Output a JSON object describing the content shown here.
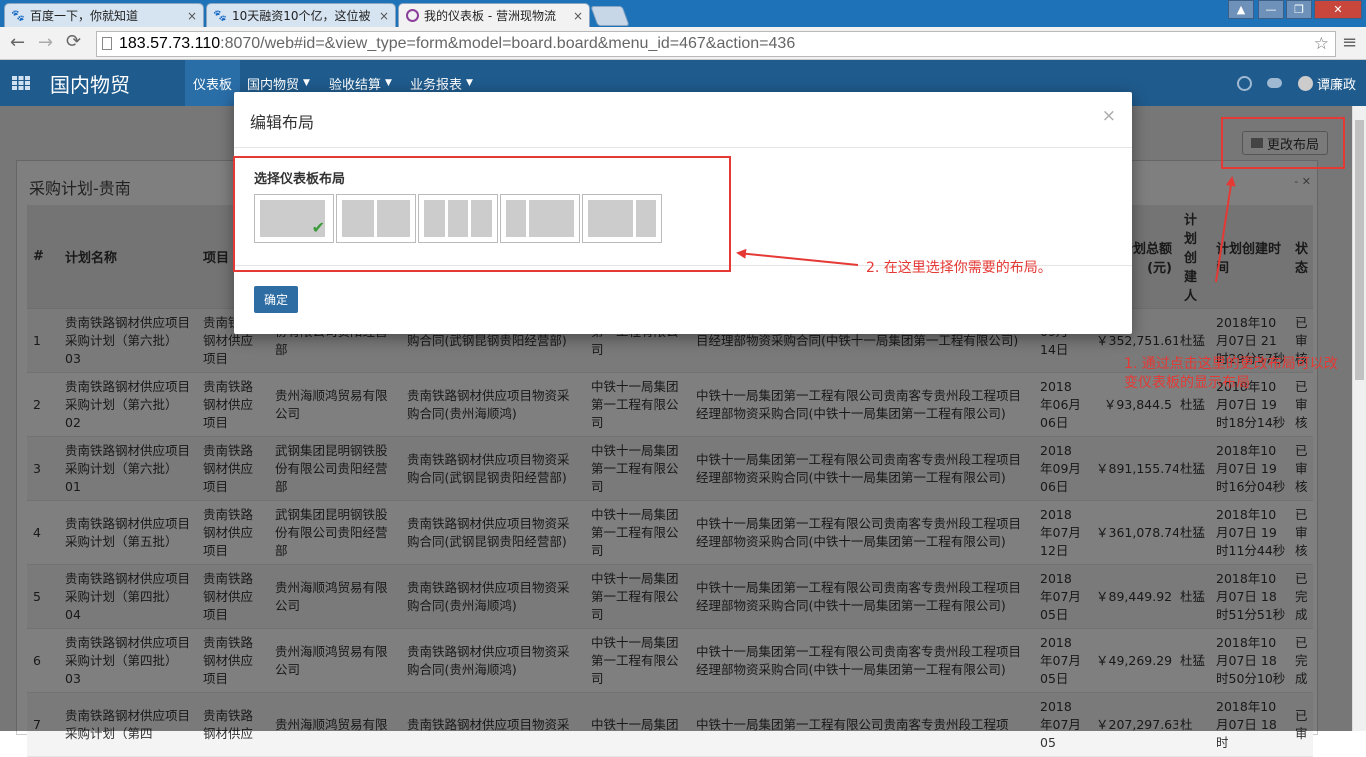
{
  "browser": {
    "tabs": [
      {
        "title": "百度一下，你就知道",
        "icon": "baidu-paw-icon"
      },
      {
        "title": "10天融资10个亿，这位被",
        "icon": "baidu-paw-icon"
      },
      {
        "title": "我的仪表板 - 营洲现物流",
        "icon": "odoo-ring-icon"
      }
    ],
    "url_host": "183.57.73.110",
    "url_rest": ":8070/web#id=&view_type=form&model=board.board&menu_id=467&action=436"
  },
  "app": {
    "title": "国内物贸",
    "menus": [
      {
        "label": "仪表板",
        "caret": false
      },
      {
        "label": "国内物贸",
        "caret": true
      },
      {
        "label": "验收结算",
        "caret": true
      },
      {
        "label": "业务报表",
        "caret": true
      }
    ],
    "user": "谭廉政"
  },
  "dashboard": {
    "change_layout_label": "更改布局",
    "panel_title": "采购计划-贵南",
    "panel_tools": "- ✕",
    "columns": [
      "#",
      "计划名称",
      "项目",
      "",
      "",
      "",
      "",
      "",
      "计划总额(元)",
      "计划创建人",
      "计划创建时间",
      "状态"
    ],
    "rows": [
      {
        "no": "1",
        "name": "贵南铁路钢材供应项目采购计划（第六批）03",
        "project": "贵南铁路钢材供应项目",
        "supplier": "份有限公司贵阳经营部",
        "contract": "购合同(武钢昆钢贵阳经营部)",
        "unit": "第一工程有限公司",
        "detail": "目经理部物资采购合同(中铁十一局集团第一工程有限公司)",
        "date": "09月14日",
        "amount": "￥352,751.61",
        "creator": "杜猛",
        "created": "2018年10月07日 21时29分57秒",
        "status": "已审核"
      },
      {
        "no": "2",
        "name": "贵南铁路钢材供应项目采购计划（第六批）02",
        "project": "贵南铁路钢材供应项目",
        "supplier": "贵州海顺鸿贸易有限公司",
        "contract": "贵南铁路钢材供应项目物资采购合同(贵州海顺鸿)",
        "unit": "中铁十一局集团第一工程有限公司",
        "detail": "中铁十一局集团第一工程有限公司贵南客专贵州段工程项目经理部物资采购合同(中铁十一局集团第一工程有限公司)",
        "date": "2018年06月06日",
        "amount": "￥93,844.5",
        "creator": "杜猛",
        "created": "2018年10月07日 19时18分14秒",
        "status": "已审核"
      },
      {
        "no": "3",
        "name": "贵南铁路钢材供应项目采购计划（第六批）01",
        "project": "贵南铁路钢材供应项目",
        "supplier": "武钢集团昆明钢铁股份有限公司贵阳经营部",
        "contract": "贵南铁路钢材供应项目物资采购合同(武钢昆钢贵阳经营部)",
        "unit": "中铁十一局集团第一工程有限公司",
        "detail": "中铁十一局集团第一工程有限公司贵南客专贵州段工程项目经理部物资采购合同(中铁十一局集团第一工程有限公司)",
        "date": "2018年09月06日",
        "amount": "￥891,155.74",
        "creator": "杜猛",
        "created": "2018年10月07日 19时16分04秒",
        "status": "已审核"
      },
      {
        "no": "4",
        "name": "贵南铁路钢材供应项目采购计划（第五批）",
        "project": "贵南铁路钢材供应项目",
        "supplier": "武钢集团昆明钢铁股份有限公司贵阳经营部",
        "contract": "贵南铁路钢材供应项目物资采购合同(武钢昆钢贵阳经营部)",
        "unit": "中铁十一局集团第一工程有限公司",
        "detail": "中铁十一局集团第一工程有限公司贵南客专贵州段工程项目经理部物资采购合同(中铁十一局集团第一工程有限公司)",
        "date": "2018年07月12日",
        "amount": "￥361,078.74",
        "creator": "杜猛",
        "created": "2018年10月07日 19时11分44秒",
        "status": "已审核"
      },
      {
        "no": "5",
        "name": "贵南铁路钢材供应项目采购计划（第四批）04",
        "project": "贵南铁路钢材供应项目",
        "supplier": "贵州海顺鸿贸易有限公司",
        "contract": "贵南铁路钢材供应项目物资采购合同(贵州海顺鸿)",
        "unit": "中铁十一局集团第一工程有限公司",
        "detail": "中铁十一局集团第一工程有限公司贵南客专贵州段工程项目经理部物资采购合同(中铁十一局集团第一工程有限公司)",
        "date": "2018年07月05日",
        "amount": "￥89,449.92",
        "creator": "杜猛",
        "created": "2018年10月07日 18时51分51秒",
        "status": "已完成"
      },
      {
        "no": "6",
        "name": "贵南铁路钢材供应项目采购计划（第四批）03",
        "project": "贵南铁路钢材供应项目",
        "supplier": "贵州海顺鸿贸易有限公司",
        "contract": "贵南铁路钢材供应项目物资采购合同(贵州海顺鸿)",
        "unit": "中铁十一局集团第一工程有限公司",
        "detail": "中铁十一局集团第一工程有限公司贵南客专贵州段工程项目经理部物资采购合同(中铁十一局集团第一工程有限公司)",
        "date": "2018年07月05日",
        "amount": "￥49,269.29",
        "creator": "杜猛",
        "created": "2018年10月07日 18时50分10秒",
        "status": "已完成"
      },
      {
        "no": "7",
        "name": "贵南铁路钢材供应项目采购计划（第四",
        "project": "贵南铁路钢材供应",
        "supplier": "贵州海顺鸿贸易有限",
        "contract": "贵南铁路钢材供应项目物资采",
        "unit": "中铁十一局集团",
        "detail": "中铁十一局集团第一工程有限公司贵南客专贵州段工程项",
        "date": "2018年07月05",
        "amount": "￥207,297.63",
        "creator": "杜",
        "created": "2018年10月07日 18时",
        "status": "已审"
      }
    ]
  },
  "modal": {
    "title": "编辑布局",
    "close": "×",
    "section_label": "选择仪表板布局",
    "layouts": [
      {
        "name": "layout-1",
        "columns": 1,
        "selected": true
      },
      {
        "name": "layout-1-1",
        "columns": 2,
        "selected": false
      },
      {
        "name": "layout-1-1-1",
        "columns": 3,
        "selected": false
      },
      {
        "name": "layout-1-2",
        "columns": 2,
        "selected": false
      },
      {
        "name": "layout-2-1",
        "columns": 2,
        "selected": false
      }
    ],
    "confirm_label": "确定"
  },
  "annotations": {
    "step1": "1. 通过点击这里的更改布局可以改变仪表板的显示布局",
    "step2": "2. 在这里选择你需要的布局。",
    "color": "#e53935"
  },
  "colors": {
    "navbar": "#1f5b8d",
    "primary_button": "#2e6da4",
    "check": "#3a9a3a"
  }
}
